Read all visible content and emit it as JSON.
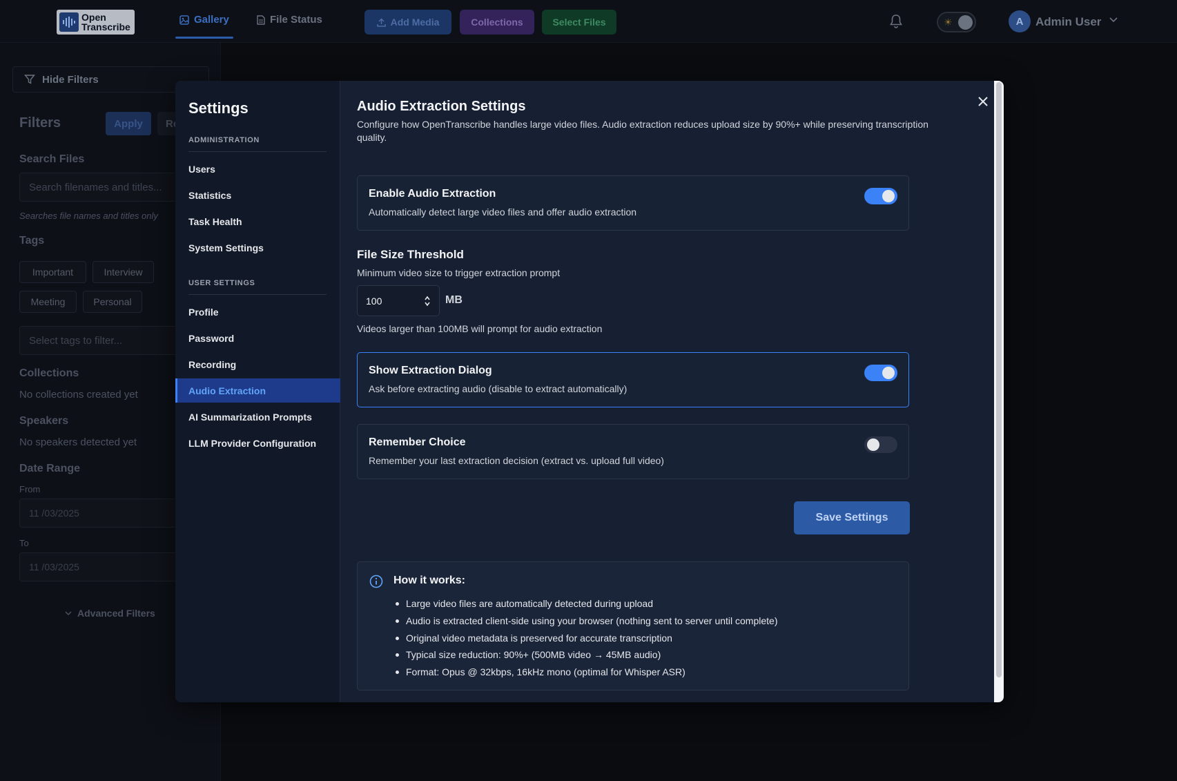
{
  "app": {
    "logo_line1": "Open",
    "logo_line2": "Transcribe"
  },
  "topnav": {
    "tabs": [
      {
        "label": "Gallery",
        "icon": "image-icon",
        "active": true
      },
      {
        "label": "File Status",
        "icon": "document-icon",
        "active": false
      }
    ],
    "add_media": "Add Media",
    "collections": "Collections",
    "select_files": "Select Files",
    "user_initial": "A",
    "user_name": "Admin User"
  },
  "filters": {
    "hide_filters": "Hide Filters",
    "title": "Filters",
    "apply": "Apply",
    "reset": "Re",
    "search_title": "Search Files",
    "search_placeholder": "Search filenames and titles...",
    "search_hint": "Searches file names and titles only",
    "tags_title": "Tags",
    "tags": [
      "Important",
      "Interview",
      "Meeting",
      "Personal"
    ],
    "tags_placeholder": "Select tags to filter...",
    "collections_title": "Collections",
    "collections_empty": "No collections created yet",
    "speakers_title": "Speakers",
    "speakers_empty": "No speakers detected yet",
    "date_title": "Date Range",
    "from_label": "From",
    "from_month": "11",
    "from_day": "03",
    "from_year": "2025",
    "to_label": "To",
    "to_month": "11",
    "to_day": "03",
    "to_year": "2025",
    "advanced": "Advanced Filters"
  },
  "settings": {
    "title": "Settings",
    "section_admin": "ADMINISTRATION",
    "admin_items": [
      "Users",
      "Statistics",
      "Task Health",
      "System Settings"
    ],
    "section_user": "USER SETTINGS",
    "user_items": [
      "Profile",
      "Password",
      "Recording",
      "Audio Extraction",
      "AI Summarization Prompts",
      "LLM Provider Configuration"
    ],
    "active_item": "Audio Extraction"
  },
  "audio_extraction": {
    "heading": "Audio Extraction Settings",
    "description": "Configure how OpenTranscribe handles large video files. Audio extraction reduces upload size by 90%+ while preserving transcription quality.",
    "enable": {
      "title": "Enable Audio Extraction",
      "subtitle": "Automatically detect large video files and offer audio extraction",
      "on": true
    },
    "threshold": {
      "title": "File Size Threshold",
      "subtitle": "Minimum video size to trigger extraction prompt",
      "value": "100",
      "unit": "MB",
      "note": "Videos larger than 100MB will prompt for audio extraction"
    },
    "show_dialog": {
      "title": "Show Extraction Dialog",
      "subtitle": "Ask before extracting audio (disable to extract automatically)",
      "on": true
    },
    "remember": {
      "title": "Remember Choice",
      "subtitle": "Remember your last extraction decision (extract vs. upload full video)",
      "on": false
    },
    "save": "Save Settings",
    "how_title": "How it works:",
    "how_items": [
      "Large video files are automatically detected during upload",
      "Audio is extracted client-side using your browser (nothing sent to server until complete)",
      "Original video metadata is preserved for accurate transcription",
      "Typical size reduction: 90%+ (500MB video → 45MB audio)",
      "Format: Opus @ 32kbps, 16kHz mono (optimal for Whisper ASR)"
    ]
  },
  "colors": {
    "accent": "#3b82f6",
    "modal_bg": "#172033",
    "nav_active_bg": "#1e3a8a"
  }
}
